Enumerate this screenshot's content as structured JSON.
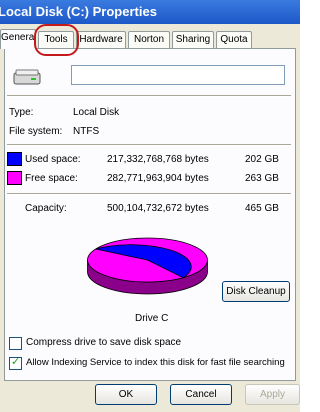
{
  "window": {
    "title": "Local Disk (C:) Properties"
  },
  "tabs": [
    {
      "label": "General"
    },
    {
      "label": "Tools"
    },
    {
      "label": "Hardware"
    },
    {
      "label": "Norton"
    },
    {
      "label": "Sharing"
    },
    {
      "label": "Quota"
    }
  ],
  "general": {
    "volume_label_value": "",
    "type_label": "Type:",
    "type_value": "Local Disk",
    "fs_label": "File system:",
    "fs_value": "NTFS",
    "used_label": "Used space:",
    "used_bytes": "217,332,768,768 bytes",
    "used_gb": "202 GB",
    "free_label": "Free space:",
    "free_bytes": "282,771,963,904 bytes",
    "free_gb": "263 GB",
    "capacity_label": "Capacity:",
    "capacity_bytes": "500,104,732,672 bytes",
    "capacity_gb": "465 GB",
    "drive_label": "Drive C",
    "disk_cleanup_label": "Disk Cleanup",
    "compress_label": "Compress drive to save disk space",
    "index_label": "Allow Indexing Service to index this disk for fast file searching",
    "compress_checked": false,
    "index_checked": true,
    "used_fraction": 0.4346
  },
  "colors": {
    "used": "#0000ff",
    "free": "#ff00ff"
  },
  "buttons": {
    "ok": "OK",
    "cancel": "Cancel",
    "apply": "Apply"
  }
}
